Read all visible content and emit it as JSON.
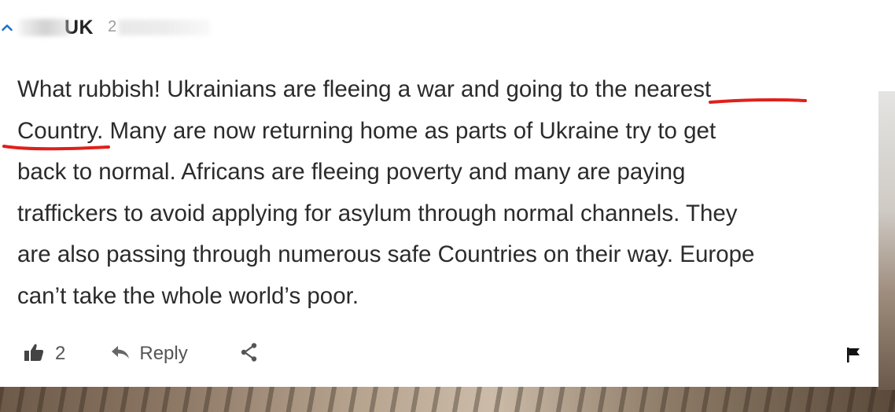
{
  "comment": {
    "username": "UK",
    "timestamp": "2",
    "lines": [
      "What rubbish! Ukrainians are fleeing a war and going to the nearest",
      "Country. Many are now returning home as parts of Ukraine try to get",
      "back to normal. Africans are fleeing poverty and many are paying",
      "traffickers to avoid applying for asylum through normal channels. They",
      "are also passing through numerous safe Countries on their way. Europe",
      "can’t take the whole world’s poor."
    ]
  },
  "actions": {
    "like_count": "2",
    "reply_label": "Reply"
  },
  "annotations": {
    "underline_color": "#e0201b"
  },
  "icons": {
    "collapse": "chevron-up-icon",
    "like": "thumbs-up-icon",
    "reply": "reply-arrow-icon",
    "share": "share-icon",
    "flag": "flag-icon"
  },
  "colors": {
    "accent": "#1a6fd1",
    "text": "#2b2b2b",
    "muted": "#555555"
  }
}
